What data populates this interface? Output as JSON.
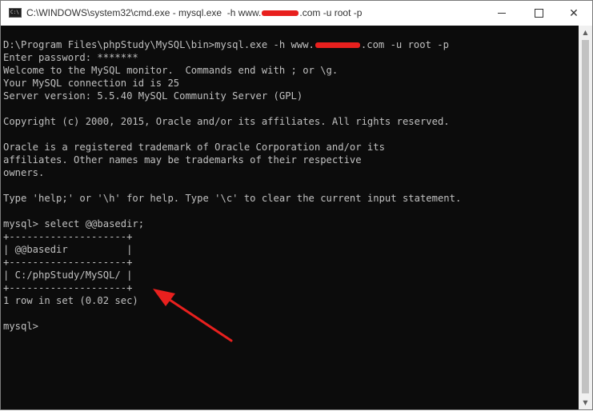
{
  "titlebar": {
    "title_prefix": "C:\\WINDOWS\\system32\\cmd.exe - mysql.exe  -h www.",
    "title_suffix": ".com -u root -p",
    "icon_text": "C:\\",
    "minimize": "",
    "maximize": "",
    "close": "✕"
  },
  "console": {
    "lines": [
      "D:\\Program Files\\phpStudy\\MySQL\\bin>mysql.exe -h www.",
      "Enter password: *******",
      "Welcome to the MySQL monitor.  Commands end with ; or \\g.",
      "Your MySQL connection id is 25",
      "Server version: 5.5.40 MySQL Community Server (GPL)",
      "",
      "Copyright (c) 2000, 2015, Oracle and/or its affiliates. All rights reserved.",
      "",
      "Oracle is a registered trademark of Oracle Corporation and/or its",
      "affiliates. Other names may be trademarks of their respective",
      "owners.",
      "",
      "Type 'help;' or '\\h' for help. Type '\\c' to clear the current input statement.",
      "",
      "mysql> select @@basedir;",
      "+--------------------+",
      "| @@basedir          |",
      "+--------------------+",
      "| C:/phpStudy/MySQL/ |",
      "+--------------------+",
      "1 row in set (0.02 sec)",
      "",
      "mysql>"
    ],
    "command_suffix": ".com -u root -p"
  },
  "scrollbar": {
    "up": "▲",
    "down": "▼"
  },
  "colors": {
    "console_bg": "#0c0c0c",
    "console_text": "#c0c0c0",
    "annotation": "#e8201e"
  }
}
